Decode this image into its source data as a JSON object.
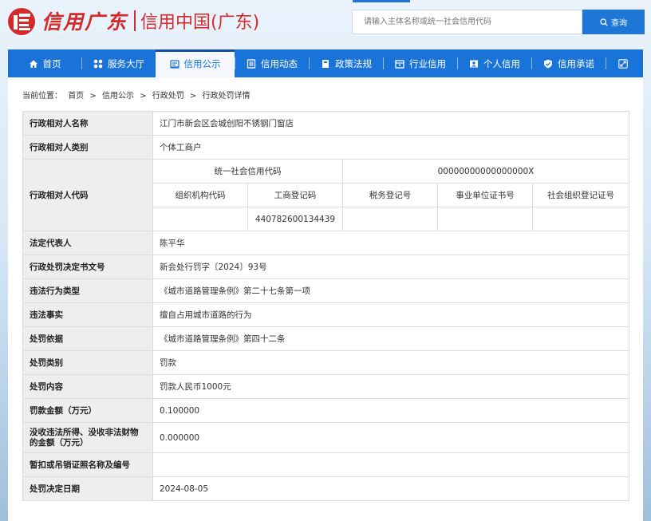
{
  "header": {
    "logo_script": "信用广东",
    "logo_text": "信用中国(广东)",
    "search_placeholder": "请输入主体名称或统一社会信用代码",
    "search_button": "查询"
  },
  "nav": {
    "items": [
      {
        "label": "首页",
        "icon": "home-icon"
      },
      {
        "label": "服务大厅",
        "icon": "grid-icon"
      },
      {
        "label": "信用公示",
        "icon": "announce-icon"
      },
      {
        "label": "信用动态",
        "icon": "news-icon"
      },
      {
        "label": "政策法规",
        "icon": "book-icon"
      },
      {
        "label": "行业信用",
        "icon": "industry-icon"
      },
      {
        "label": "个人信用",
        "icon": "person-card-icon"
      },
      {
        "label": "信用承诺",
        "icon": "shield-check-icon"
      }
    ],
    "active_index": 2
  },
  "breadcrumb": {
    "prefix": "当前位置：",
    "items": [
      "首页",
      "信用公示",
      "行政处罚",
      "行政处罚详情"
    ],
    "separator": ">"
  },
  "detail": {
    "name_label": "行政相对人名称",
    "name_value": "江门市新会区会城创阳不锈钢门窗店",
    "type_label": "行政相对人类别",
    "type_value": "个体工商户",
    "code_label": "行政相对人代码",
    "codes": {
      "uscc_label": "统一社会信用代码",
      "uscc_value": "00000000000000000X",
      "org_label": "组织机构代码",
      "org_value": "",
      "biz_reg_label": "工商登记码",
      "biz_reg_value": "440782600134439",
      "tax_label": "税务登记号",
      "tax_value": "",
      "institution_label": "事业单位证书号",
      "institution_value": "",
      "social_org_label": "社会组织登记证号",
      "social_org_value": ""
    },
    "rows": [
      {
        "label": "法定代表人",
        "value": "陈平华"
      },
      {
        "label": "行政处罚决定书文号",
        "value": "新会处行罚字〔2024〕93号"
      },
      {
        "label": "违法行为类型",
        "value": "《城市道路管理条例》第二十七条第一项"
      },
      {
        "label": "违法事实",
        "value": "擅自占用城市道路的行为"
      },
      {
        "label": "处罚依据",
        "value": "《城市道路管理条例》第四十二条"
      },
      {
        "label": "处罚类别",
        "value": "罚款"
      },
      {
        "label": "处罚内容",
        "value": "罚款人民币1000元"
      },
      {
        "label": "罚款金额（万元）",
        "value": "0.100000"
      },
      {
        "label": "没收违法所得、没收非法财物的金额（万元）",
        "value": "0.000000"
      },
      {
        "label": "暂扣或吊销证照名称及编号",
        "value": ""
      },
      {
        "label": "处罚决定日期",
        "value": "2024-08-05"
      }
    ]
  },
  "colors": {
    "brand_red": "#d32a2a",
    "nav_blue": "#1a73d9",
    "label_bg": "#eeeeee"
  }
}
